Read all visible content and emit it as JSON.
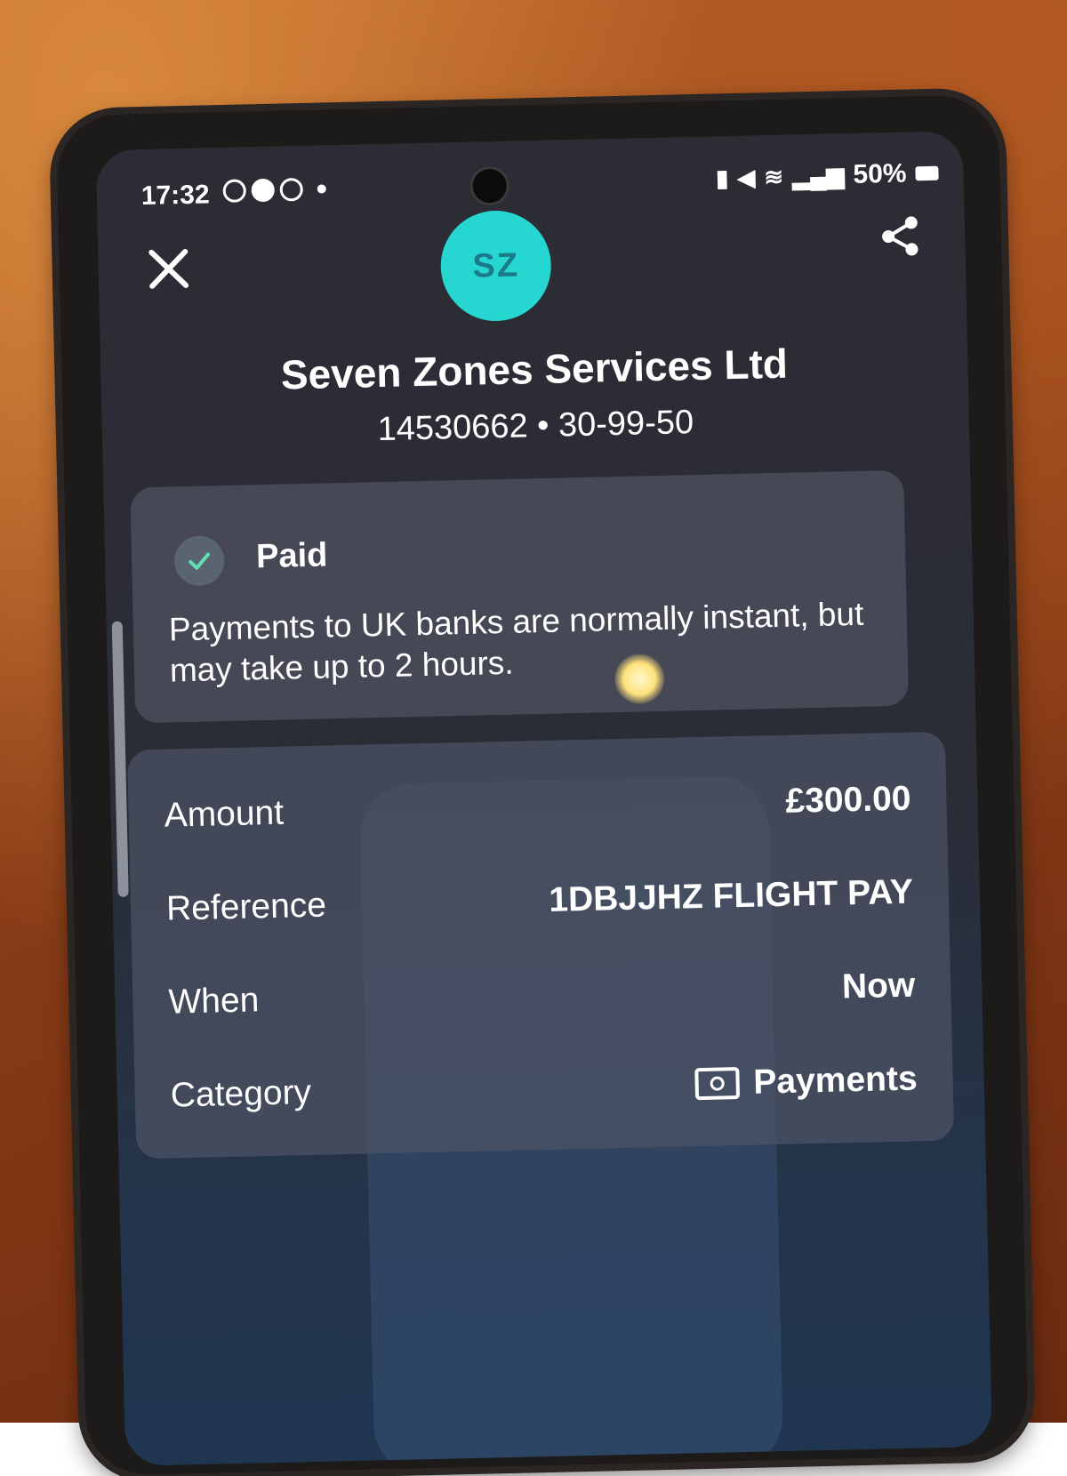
{
  "status_bar": {
    "time": "17:32",
    "battery": "50%"
  },
  "header": {
    "avatar_initials": "SZ",
    "payee_name": "Seven Zones Services Ltd",
    "account_line": "14530662 • 30-99-50",
    "close_icon": "close-icon",
    "share_icon": "share-icon"
  },
  "status_card": {
    "title": "Paid",
    "message": "Payments to UK banks are normally instant, but may take up to 2 hours."
  },
  "details": [
    {
      "label": "Amount",
      "value": "£300.00"
    },
    {
      "label": "Reference",
      "value": "1DBJJHZ FLIGHT PAY"
    },
    {
      "label": "When",
      "value": "Now"
    },
    {
      "label": "Category",
      "value": "Payments",
      "icon": "banknote-icon"
    }
  ],
  "colors": {
    "avatar_bg": "#25d6d1",
    "avatar_text": "#1b7a88",
    "screen_bg": "#2c2c34",
    "card_bg": "#50525f"
  }
}
